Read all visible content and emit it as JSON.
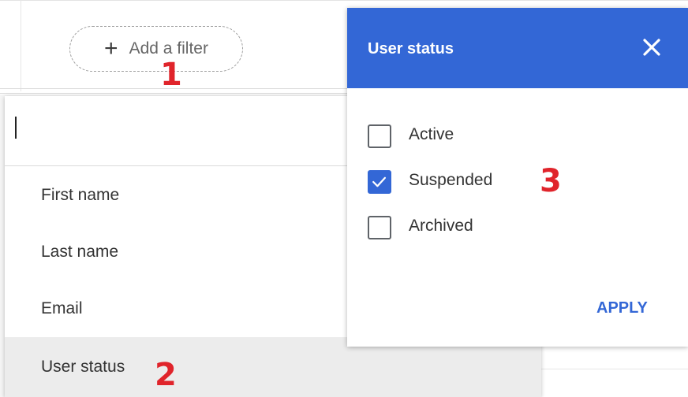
{
  "add_filter": {
    "plus_glyph": "+",
    "label": "Add a filter"
  },
  "dropdown": {
    "options": [
      "First name",
      "Last name",
      "Email",
      "User status"
    ]
  },
  "panel": {
    "title": "User status",
    "close_glyph": "✕",
    "options": [
      {
        "label": "Active",
        "checked": false
      },
      {
        "label": "Suspended",
        "checked": true
      },
      {
        "label": "Archived",
        "checked": false
      }
    ],
    "apply_label": "APPLY"
  },
  "annotations": {
    "step1": "1",
    "step2": "2",
    "step3": "3"
  },
  "colors": {
    "accent": "#3367d6",
    "annotation": "#e0242b"
  }
}
